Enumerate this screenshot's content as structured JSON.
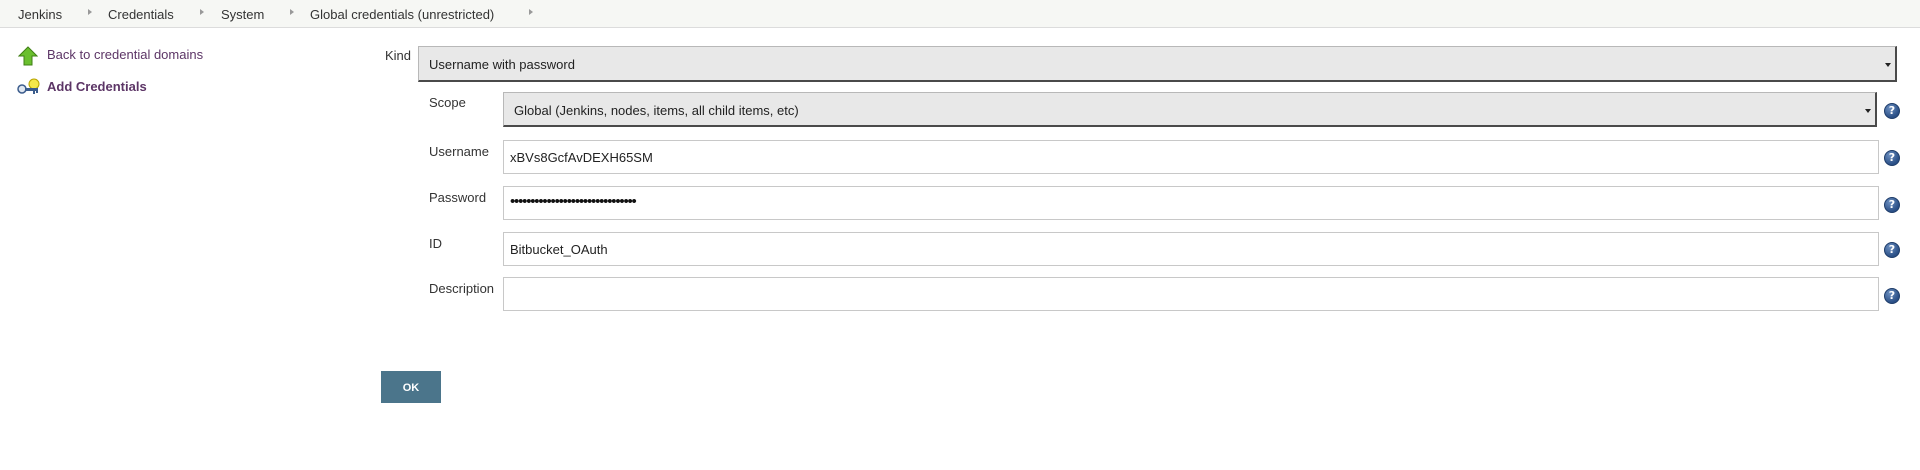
{
  "breadcrumb": {
    "items": [
      "Jenkins",
      "Credentials",
      "System",
      "Global credentials (unrestricted)"
    ]
  },
  "sidebar": {
    "back_link": "Back to credential domains",
    "add_link": "Add Credentials"
  },
  "form": {
    "kind": {
      "label": "Kind",
      "value": "Username with password"
    },
    "scope": {
      "label": "Scope",
      "value": "Global (Jenkins, nodes, items, all child items, etc)"
    },
    "username": {
      "label": "Username",
      "value": "xBVs8GcfAvDEXH65SM"
    },
    "password": {
      "label": "Password",
      "value": "•••••••••••••••••••••••••••••••"
    },
    "id": {
      "label": "ID",
      "value": "Bitbucket_OAuth"
    },
    "description": {
      "label": "Description",
      "value": ""
    },
    "help_icon": "?"
  },
  "ok_label": "OK",
  "colors": {
    "link": "#5c3566",
    "ok_button": "#4b758b",
    "help_icon": "#2a4f86"
  }
}
